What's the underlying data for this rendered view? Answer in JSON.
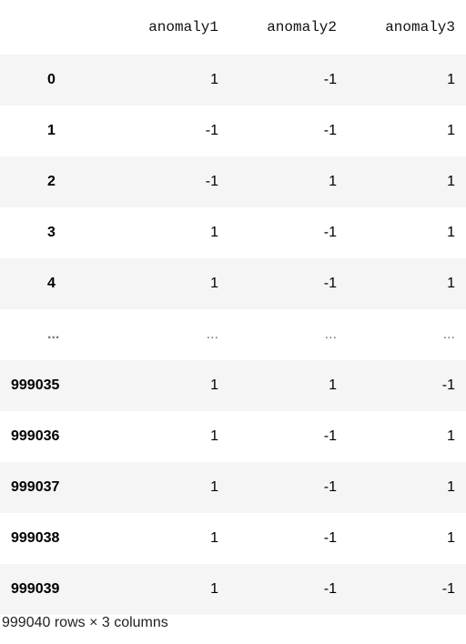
{
  "table": {
    "columns": [
      "anomaly1",
      "anomaly2",
      "anomaly3"
    ],
    "rows": [
      {
        "index": "0",
        "values": [
          "1",
          "-1",
          "1"
        ]
      },
      {
        "index": "1",
        "values": [
          "-1",
          "-1",
          "1"
        ]
      },
      {
        "index": "2",
        "values": [
          "-1",
          "1",
          "1"
        ]
      },
      {
        "index": "3",
        "values": [
          "1",
          "-1",
          "1"
        ]
      },
      {
        "index": "4",
        "values": [
          "1",
          "-1",
          "1"
        ]
      },
      {
        "index": "...",
        "values": [
          "...",
          "...",
          "..."
        ]
      },
      {
        "index": "999035",
        "values": [
          "1",
          "1",
          "-1"
        ]
      },
      {
        "index": "999036",
        "values": [
          "1",
          "-1",
          "1"
        ]
      },
      {
        "index": "999037",
        "values": [
          "1",
          "-1",
          "1"
        ]
      },
      {
        "index": "999038",
        "values": [
          "1",
          "-1",
          "1"
        ]
      },
      {
        "index": "999039",
        "values": [
          "1",
          "-1",
          "-1"
        ]
      }
    ],
    "shape_text": "999040 rows × 3 columns"
  }
}
